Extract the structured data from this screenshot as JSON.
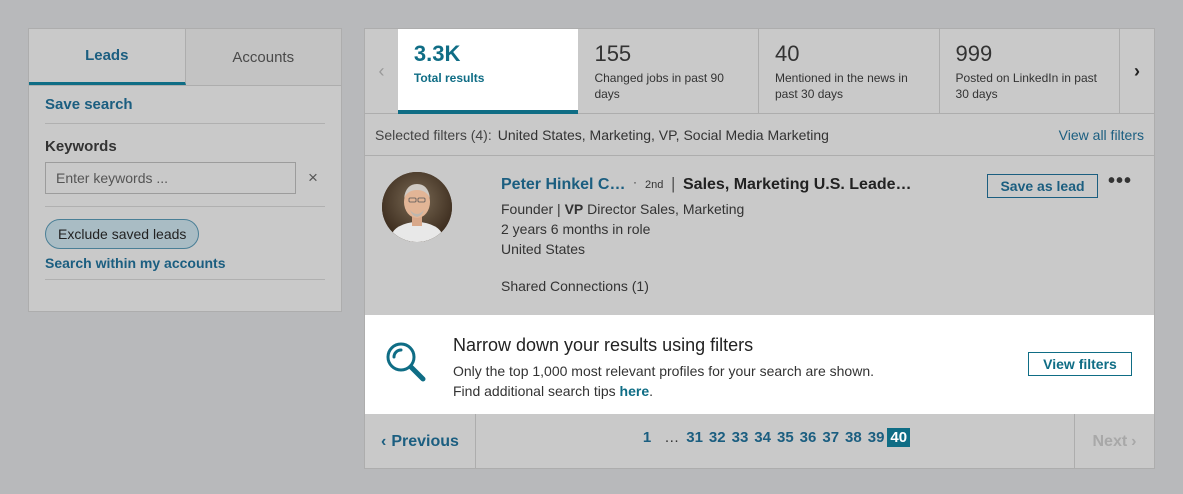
{
  "left_panel": {
    "tabs": [
      {
        "label": "Leads",
        "active": true
      },
      {
        "label": "Accounts",
        "active": false
      }
    ],
    "save_search": "Save search",
    "keywords_label": "Keywords",
    "keywords_placeholder": "Enter keywords ...",
    "keywords_value": "",
    "clear_icon": "×",
    "exclude_saved_leads": "Exclude saved leads",
    "search_within_accounts": "Search within my accounts"
  },
  "stats": {
    "prev_icon": "‹",
    "next_icon": "›",
    "items": [
      {
        "value": "3.3K",
        "label": "Total results",
        "active": true
      },
      {
        "value": "155",
        "label": "Changed jobs in past 90 days",
        "active": false
      },
      {
        "value": "40",
        "label": "Mentioned in the news in past 30 days",
        "active": false
      },
      {
        "value": "999",
        "label": "Posted on LinkedIn in past 30 days",
        "active": false
      }
    ]
  },
  "filters": {
    "label": "Selected filters (4):",
    "values": "United States, Marketing, VP, Social Media Marketing",
    "view_all": "View all filters"
  },
  "result": {
    "name": "Peter Hinkel C…",
    "dot": "·",
    "degree": "2nd",
    "bar": "|",
    "company": "Sales, Marketing U.S. Leade…",
    "title_prefix": "Founder | ",
    "title_bold": "VP",
    "title_suffix": " Director Sales, Marketing",
    "tenure": "2 years 6 months in role",
    "location": "United States",
    "shared": "Shared Connections (1)",
    "save_button": "Save as lead",
    "more_icon": "•••"
  },
  "tip": {
    "title": "Narrow down your results using filters",
    "line1": "Only the top 1,000 most relevant profiles for your search are shown.",
    "line2_prefix": "Find additional search tips  ",
    "line2_link": "here",
    "line2_suffix": ".",
    "button": "View filters"
  },
  "pagination": {
    "previous": "Previous",
    "next": "Next",
    "prev_icon": "‹",
    "next_icon": "›",
    "first": "1",
    "ellipsis": "…",
    "pages": [
      "31",
      "32",
      "33",
      "34",
      "35",
      "36",
      "37",
      "38",
      "39"
    ],
    "current": "40"
  },
  "colors": {
    "accent": "#0f6d85",
    "link": "#1b5e80",
    "overlay_bg": "#b8b9bb",
    "panel_bg": "#c9c9c9"
  }
}
